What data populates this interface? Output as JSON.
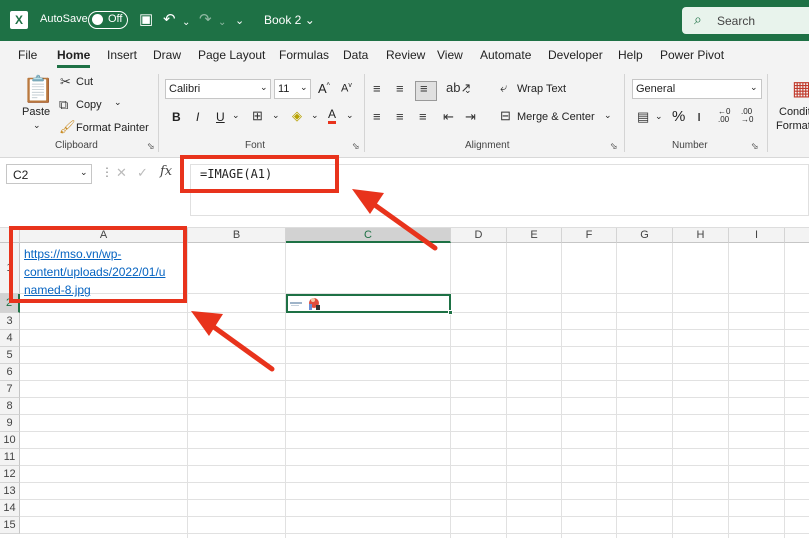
{
  "titlebar": {
    "autosave_label": "AutoSave",
    "autosave_state": "Off",
    "book_title": "Book 2",
    "search_placeholder": "Search"
  },
  "menu": [
    "File",
    "Home",
    "Insert",
    "Draw",
    "Page Layout",
    "Formulas",
    "Data",
    "Review",
    "View",
    "Automate",
    "Developer",
    "Help",
    "Power Pivot"
  ],
  "ribbon": {
    "clipboard": {
      "paste": "Paste",
      "cut": "Cut",
      "copy": "Copy",
      "format_painter": "Format Painter",
      "group": "Clipboard"
    },
    "font": {
      "family": "Calibri",
      "size": "11",
      "group": "Font"
    },
    "alignment": {
      "wrap_text": "Wrap Text",
      "merge_center": "Merge & Center",
      "group": "Alignment"
    },
    "number": {
      "format": "General",
      "group": "Number"
    },
    "styles": {
      "conditional": "Conditional",
      "format_as": "Format as"
    }
  },
  "formula_bar": {
    "name_box": "C2",
    "fx": "fx",
    "formula": "=IMAGE(A1)"
  },
  "sheet": {
    "columns": [
      "A",
      "B",
      "C",
      "D",
      "E",
      "F",
      "G",
      "H",
      "I"
    ],
    "rows": [
      "1",
      "2",
      "3",
      "4",
      "5",
      "6",
      "7",
      "8",
      "9",
      "10",
      "11",
      "12",
      "13",
      "14",
      "15"
    ],
    "a1_lines": [
      "https://mso.vn/wp-",
      "content/uploads/2022/01/u",
      "named-8.jpg"
    ]
  },
  "colors": {
    "excel_green": "#1e7145",
    "annotation_red": "#e8331c",
    "link_blue": "#0563c1"
  }
}
